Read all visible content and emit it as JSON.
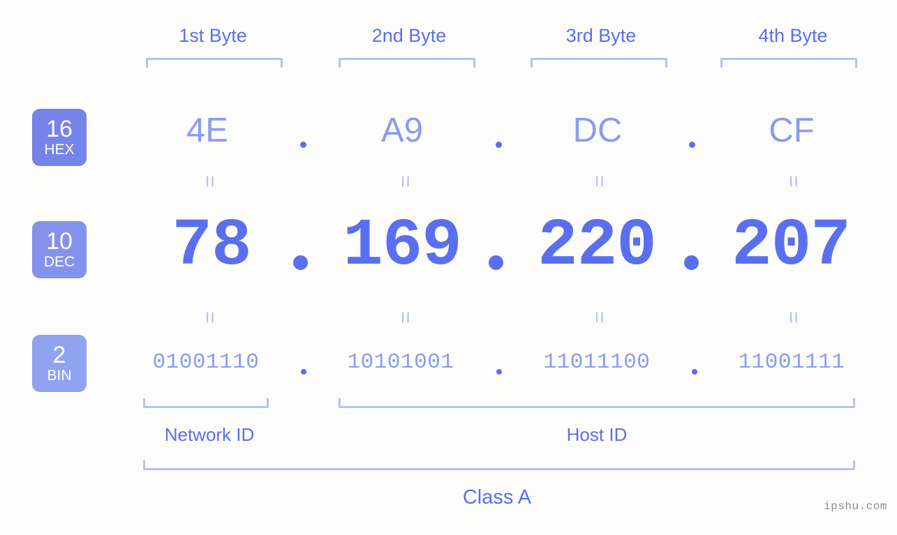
{
  "theme": {
    "background": "#fcfdfa",
    "accent_strong": "#5a6ff0",
    "accent_light": "#8b9bf2",
    "bracket": "#b5c0f7",
    "badge_hex_bg": "#7683e8",
    "badge_dec_bg": "#8592ec",
    "badge_bin_bg": "#8fa3f0",
    "watermark_color": "#8d8d8d"
  },
  "byte_headers": [
    {
      "label": "1st Byte"
    },
    {
      "label": "2nd Byte"
    },
    {
      "label": "3rd Byte"
    },
    {
      "label": "4th Byte"
    }
  ],
  "radix_badges": [
    {
      "number": "16",
      "name": "HEX"
    },
    {
      "number": "10",
      "name": "DEC"
    },
    {
      "number": "2",
      "name": "BIN"
    }
  ],
  "rows": {
    "hex": {
      "values": [
        "4E",
        "A9",
        "DC",
        "CF"
      ],
      "separator": "."
    },
    "dec": {
      "values": [
        "78",
        "169",
        "220",
        "207"
      ],
      "separator": "."
    },
    "bin": {
      "values": [
        "01001110",
        "10101001",
        "11011100",
        "11001111"
      ],
      "separator": "."
    }
  },
  "equals_marks": {
    "symbol": "=",
    "count_per_row": 4,
    "rows": 2
  },
  "segments": [
    {
      "label": "Network ID"
    },
    {
      "label": "Host ID"
    }
  ],
  "ip_class": {
    "label": "Class A"
  },
  "watermark": {
    "text": "ipshu.com"
  }
}
